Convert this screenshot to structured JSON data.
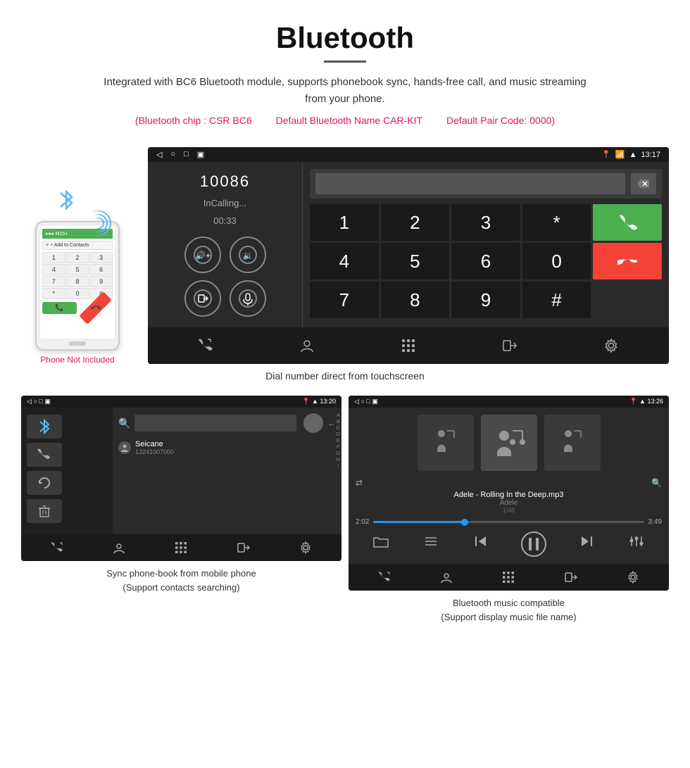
{
  "header": {
    "title": "Bluetooth",
    "description": "Integrated with BC6 Bluetooth module, supports phonebook sync, hands-free call, and music streaming from your phone.",
    "specs": [
      "(Bluetooth chip : CSR BC6",
      "Default Bluetooth Name CAR-KIT",
      "Default Pair Code: 0000)"
    ]
  },
  "phone_illustration": {
    "not_included_label": "Phone Not Included",
    "status_bar": "M15+",
    "add_contacts": "+ Add to Contacts",
    "keys": [
      "1",
      "2",
      "3",
      "4",
      "5",
      "6",
      "7",
      "8",
      "9",
      "*",
      "0",
      "#"
    ],
    "call_green": "📞",
    "call_red": "📞"
  },
  "main_screen": {
    "status": {
      "left": [
        "◁",
        "○",
        "□",
        "▣"
      ],
      "right": "13:17",
      "icons": [
        "location",
        "phone",
        "wifi"
      ]
    },
    "call": {
      "number": "10086",
      "status": "InCalling...",
      "timer": "00:33"
    },
    "dialpad": {
      "keys": [
        "1",
        "2",
        "3",
        "*",
        "4",
        "5",
        "6",
        "0",
        "7",
        "8",
        "9",
        "#"
      ]
    },
    "caption": "Dial number direct from touchscreen"
  },
  "bottom_left": {
    "status_time": "13:20",
    "contact_name": "Seicane",
    "contact_number": "13241007000",
    "alphabet": [
      "A",
      "B",
      "C",
      "D",
      "E",
      "F",
      "G",
      "H",
      "I"
    ],
    "caption_line1": "Sync phone-book from mobile phone",
    "caption_line2": "(Support contacts searching)"
  },
  "bottom_right": {
    "status_time": "13:26",
    "song_title": "Adele - Rolling In the Deep.mp3",
    "artist": "Adele",
    "track_info": "1/48",
    "time_current": "2:02",
    "time_total": "3:49",
    "caption_line1": "Bluetooth music compatible",
    "caption_line2": "(Support display music file name)"
  }
}
